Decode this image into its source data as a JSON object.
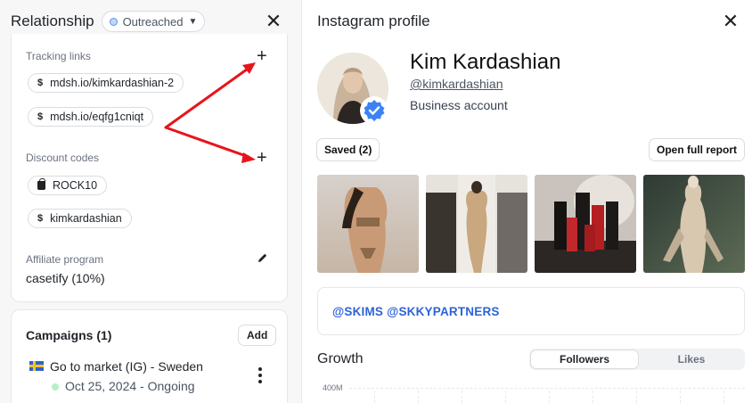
{
  "left_panel": {
    "title": "Relationship",
    "status": "Outreached",
    "tracking_links": {
      "label": "Tracking links",
      "items": [
        "mdsh.io/kimkardashian-2",
        "mdsh.io/eqfg1cniqt"
      ]
    },
    "discount_codes": {
      "label": "Discount codes",
      "items": [
        "ROCK10",
        "kimkardashian"
      ]
    },
    "affiliate_program": {
      "label": "Affiliate program",
      "value": "casetify (10%)"
    },
    "campaigns": {
      "title": "Campaigns (1)",
      "add_label": "Add",
      "items": [
        {
          "name": "Go to market (IG) - Sweden",
          "date": "Oct 25, 2024 - Ongoing"
        }
      ]
    }
  },
  "right_panel": {
    "title": "Instagram profile",
    "name": "Kim Kardashian",
    "handle": "@kimkardashian",
    "account_type": "Business account",
    "saved_label": "Saved (2)",
    "report_label": "Open full report",
    "bio_mentions": [
      "@SKIMS",
      "@SKKYPARTNERS"
    ],
    "growth": {
      "title": "Growth",
      "tabs": [
        "Followers",
        "Likes"
      ],
      "active_tab": "Followers",
      "y_tick": "400M"
    }
  },
  "icons": {
    "close": "close-icon",
    "plus": "plus-icon",
    "dollar": "dollar-icon",
    "shopping_bag": "shopping-bag-icon",
    "pencil": "pencil-icon",
    "verified": "verified-badge-icon",
    "kebab": "more-vertical-icon",
    "flag": "sweden-flag-icon"
  },
  "colors": {
    "annotation_arrow": "#e8141b",
    "link_blue": "#2c63d6",
    "status_dot": "#5b93e8",
    "ongoing_dot": "#b7efc5",
    "verified_blue": "#3b82f6"
  }
}
